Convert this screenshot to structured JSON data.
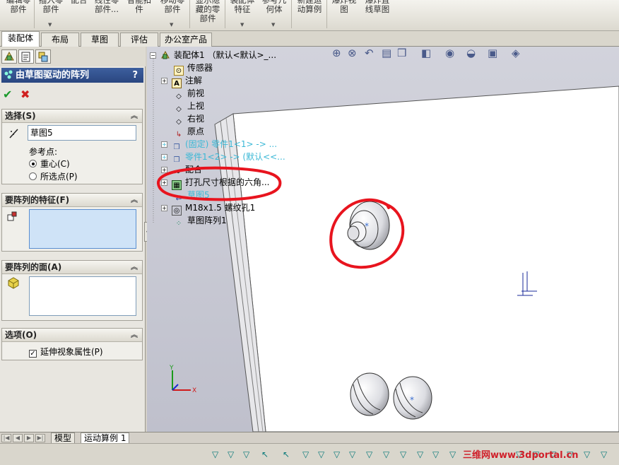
{
  "ribbon": {
    "buttons": [
      {
        "label": "编辑零\n部件"
      },
      {
        "label": "插入零\n部件"
      },
      {
        "label": "配合"
      },
      {
        "label": "线性零\n部件..."
      },
      {
        "label": "智能扣\n件"
      },
      {
        "label": "移动零\n部件"
      },
      {
        "label": "显示隐\n藏的零\n部件"
      },
      {
        "label": "装配体\n特征"
      },
      {
        "label": "参考几\n何体"
      },
      {
        "label": "新建运\n动算例"
      },
      {
        "label": "爆炸视\n图"
      },
      {
        "label": "爆炸直\n线草图"
      }
    ]
  },
  "tabs": [
    "装配体",
    "布局",
    "草图",
    "评估",
    "办公室产品"
  ],
  "property_manager": {
    "title": "由草图驱动的阵列",
    "help": "?",
    "ok": "✔",
    "cancel": "✖",
    "selection": {
      "header": "选择(S)",
      "sketch_value": "草图5",
      "ref_point_label": "参考点:",
      "radio_centroid": "重心(C)",
      "radio_selected_point": "所选点(P)"
    },
    "features_to_pattern": {
      "header": "要阵列的特征(F)"
    },
    "faces_to_pattern": {
      "header": "要阵列的面(A)"
    },
    "options": {
      "header": "选项(O)",
      "propagate_visual": "延伸视象属性(P)"
    }
  },
  "tree": {
    "root": "装配体1  （默认<默认>_...",
    "items": [
      {
        "label": "传感器"
      },
      {
        "label": "注解"
      },
      {
        "label": "前视"
      },
      {
        "label": "上视"
      },
      {
        "label": "右视"
      },
      {
        "label": "原点"
      },
      {
        "label": "(固定) 零件1<1> -> ..."
      },
      {
        "label": "零件1<2> -> (默认<<..."
      },
      {
        "label": "配合"
      },
      {
        "label": "打孔尺寸根据的六角..."
      },
      {
        "label": "草图5"
      },
      {
        "label": "M18x1.5 螺纹孔1"
      },
      {
        "label": "草图阵列1"
      }
    ]
  },
  "bottom_tabs": [
    "模型",
    "运动算例 1"
  ],
  "triad": {
    "x": "X",
    "y": "Y"
  },
  "watermark": "三维网www.3dportal.cn",
  "colors": {
    "annotation_red": "#e8141e",
    "title_blue": "#2a4680",
    "selection_blue": "#cfe3f7"
  }
}
